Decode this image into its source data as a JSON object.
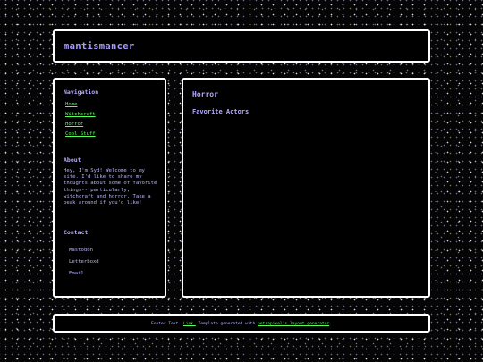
{
  "header": {
    "title": "mantismancer"
  },
  "sidebar": {
    "nav_heading": "Navigation",
    "nav_items": [
      {
        "label": "Home"
      },
      {
        "label": "Witchcraft"
      },
      {
        "label": "Horror"
      },
      {
        "label": "Cool Stuff"
      }
    ],
    "about_heading": "About",
    "about_text": "Hey, I'm Syd! Welcome to my site. I'd like to share my thoughts about some of favorite things-- particularly, witchcraft and horror. Take a peak around if you'd like!",
    "contact_heading": "Contact",
    "contact_items": [
      {
        "label": "Mastodon"
      },
      {
        "label": "Letterboxd"
      },
      {
        "label": "Email"
      }
    ]
  },
  "main": {
    "title": "Horror",
    "subtitle": "Favorite Actors"
  },
  "footer": {
    "prefix": "Footer Text.",
    "link1": "Link.",
    "middle": "Template generated with",
    "link2": "petrapixel's layout generator",
    "suffix": "."
  },
  "colors": {
    "accent_purple": "#b4aaff",
    "link_green": "#55ff55",
    "border": "#ffffff",
    "panel": "#000000"
  }
}
